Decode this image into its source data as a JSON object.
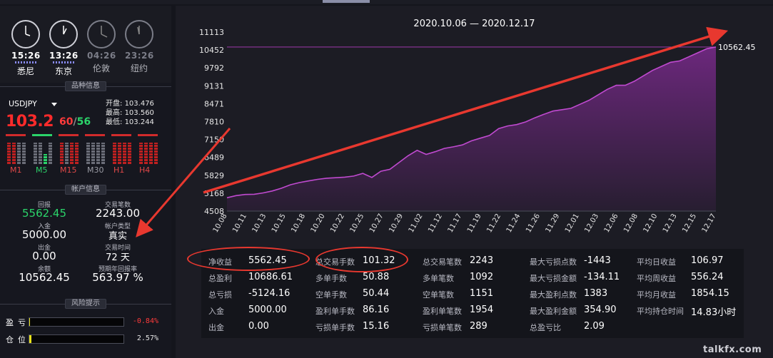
{
  "clocks": [
    {
      "time": "15:26",
      "city": "悉尼",
      "active": true
    },
    {
      "time": "13:26",
      "city": "东京",
      "active": true
    },
    {
      "time": "04:26",
      "city": "伦敦",
      "active": false
    },
    {
      "time": "23:26",
      "city": "纽约",
      "active": false
    }
  ],
  "instrument": {
    "section_title": "品种信息",
    "symbol": "USDJPY",
    "price_main": "103.2",
    "price_ask": "60",
    "price_sep": "/",
    "price_bid": "56",
    "open_label": "开盘:",
    "open": "103.476",
    "high_label": "最高:",
    "high": "103.560",
    "low_label": "最低:",
    "low": "103.244",
    "timeframes": [
      "M1",
      "M5",
      "M15",
      "M30",
      "H1",
      "H4"
    ]
  },
  "account": {
    "section_title": "帐户信息",
    "return_label": "回报",
    "return_value": "5562.45",
    "trades_label": "交易笔数",
    "trades_value": "2243.00",
    "deposit_label": "入金",
    "deposit_value": "5000.00",
    "type_label": "帐户类型",
    "type_value": "真实",
    "withdraw_label": "出金",
    "withdraw_value": "0.00",
    "duration_label": "交易时间",
    "duration_value": "72 天",
    "balance_label": "余额",
    "balance_value": "10562.45",
    "annual_label": "预期年回报率",
    "annual_value": "563.97 %"
  },
  "risk": {
    "section_title": "风险提示",
    "pl_label": "盈亏",
    "pl_value": "-0.84%",
    "pl_fill": 0.01,
    "position_label": "仓位",
    "position_value": "2.57%",
    "position_fill": 0.02
  },
  "chart_data": {
    "type": "area",
    "title": "2020.10.06 — 2020.12.17",
    "last_value_label": "10562.45",
    "ylim": [
      4508,
      11113
    ],
    "yticks": [
      "11113",
      "10452",
      "9792",
      "9131",
      "8471",
      "7810",
      "7150",
      "6489",
      "5829",
      "5168",
      "4508"
    ],
    "xticks": [
      "10.08",
      "10.11",
      "10.13",
      "10.15",
      "10.18",
      "10.20",
      "10.22",
      "10.25",
      "10.27",
      "10.29",
      "11.02",
      "11.12",
      "11.17",
      "11.19",
      "11.22",
      "11.24",
      "11.26",
      "11.29",
      "12.01",
      "12.03",
      "12.06",
      "12.08",
      "12.10",
      "12.13",
      "12.15",
      "12.17"
    ],
    "values": [
      5000,
      5080,
      5120,
      5130,
      5180,
      5250,
      5350,
      5480,
      5560,
      5620,
      5680,
      5720,
      5740,
      5760,
      5800,
      5900,
      5750,
      5980,
      6050,
      6300,
      6550,
      6750,
      6600,
      6700,
      6820,
      6880,
      6950,
      7100,
      7200,
      7300,
      7550,
      7650,
      7700,
      7800,
      7950,
      8080,
      8200,
      8250,
      8300,
      8450,
      8600,
      8800,
      9000,
      9150,
      9150,
      9300,
      9500,
      9700,
      9850,
      10000,
      10050,
      10200,
      10350,
      10500,
      10562.45
    ],
    "grid": false
  },
  "stats": [
    [
      {
        "k": "净收益",
        "v": "5562.45"
      },
      {
        "k": "总交易手数",
        "v": "101.32"
      },
      {
        "k": "总交易笔数",
        "v": "2243"
      },
      {
        "k": "最大亏损点数",
        "v": "-1443"
      },
      {
        "k": "平均日收益",
        "v": "106.97"
      }
    ],
    [
      {
        "k": "总盈利",
        "v": "10686.61"
      },
      {
        "k": "多单手数",
        "v": "50.88"
      },
      {
        "k": "多单笔数",
        "v": "1092"
      },
      {
        "k": "最大亏损金额",
        "v": "-134.11"
      },
      {
        "k": "平均周收益",
        "v": "556.24"
      }
    ],
    [
      {
        "k": "总亏损",
        "v": "-5124.16"
      },
      {
        "k": "空单手数",
        "v": "50.44"
      },
      {
        "k": "空单笔数",
        "v": "1151"
      },
      {
        "k": "最大盈利点数",
        "v": "1383"
      },
      {
        "k": "平均月收益",
        "v": "1854.15"
      }
    ],
    [
      {
        "k": "入金",
        "v": "5000.00"
      },
      {
        "k": "盈利单手数",
        "v": "86.16"
      },
      {
        "k": "盈利单笔数",
        "v": "1954"
      },
      {
        "k": "最大盈利金额",
        "v": "354.90"
      },
      {
        "k": "平均持仓时间",
        "v": "14.83小时"
      }
    ],
    [
      {
        "k": "出金",
        "v": "0.00"
      },
      {
        "k": "亏损单手数",
        "v": "15.16"
      },
      {
        "k": "亏损单笔数",
        "v": "289"
      },
      {
        "k": "总盈亏比",
        "v": "2.09"
      },
      {
        "k": "",
        "v": ""
      }
    ]
  ],
  "watermark": "talkfx.com",
  "colors": {
    "accent": "#7a2a8c",
    "up": "#2bd46a",
    "down": "#ff2b2b",
    "annotation": "#e8382f"
  }
}
